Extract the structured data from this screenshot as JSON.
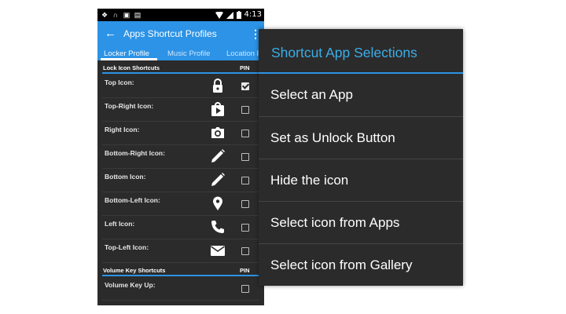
{
  "statusbar": {
    "notification_icons": [
      "dropbox-icon",
      "headphones-icon",
      "gallery-icon",
      "bag-icon"
    ],
    "right_icons": [
      "wifi-icon",
      "signal-icon",
      "battery-icon"
    ],
    "time": "4:13"
  },
  "appbar": {
    "title": "Apps Shortcut Profiles",
    "back_icon": "←",
    "overflow_icon": "⋮"
  },
  "tabs": [
    {
      "label": "Locker Profile",
      "active": true
    },
    {
      "label": "Music Profile",
      "active": false
    },
    {
      "label": "Location P",
      "active": false
    }
  ],
  "lock_section": {
    "title": "Lock Icon Shortcuts",
    "pin_header": "PIN",
    "rows": [
      {
        "label": "Top Icon:",
        "icon": "lock-icon",
        "pinned": true
      },
      {
        "label": "Top-Right Icon:",
        "icon": "play-store-icon",
        "pinned": false
      },
      {
        "label": "Right Icon:",
        "icon": "camera-icon",
        "pinned": false
      },
      {
        "label": "Bottom-Right Icon:",
        "icon": "pencil-icon",
        "pinned": false
      },
      {
        "label": "Bottom Icon:",
        "icon": "pencil-icon",
        "pinned": false
      },
      {
        "label": "Bottom-Left Icon:",
        "icon": "map-pin-icon",
        "pinned": false
      },
      {
        "label": "Left Icon:",
        "icon": "phone-icon",
        "pinned": false
      },
      {
        "label": "Top-Left Icon:",
        "icon": "mail-icon",
        "pinned": false
      }
    ]
  },
  "volume_section": {
    "title": "Volume Key Shortcuts",
    "pin_header": "PIN",
    "rows": [
      {
        "label": "Volume Key Up:",
        "pinned": false
      }
    ]
  },
  "dialog": {
    "title": "Shortcut App Selections",
    "items": [
      "Select an App",
      "Set as Unlock Button",
      "Hide the icon",
      "Select icon from Apps",
      "Select icon from Gallery"
    ]
  },
  "colors": {
    "accent": "#2c93e6",
    "dialog_title": "#3aaee8",
    "background": "#2b2b2b"
  }
}
